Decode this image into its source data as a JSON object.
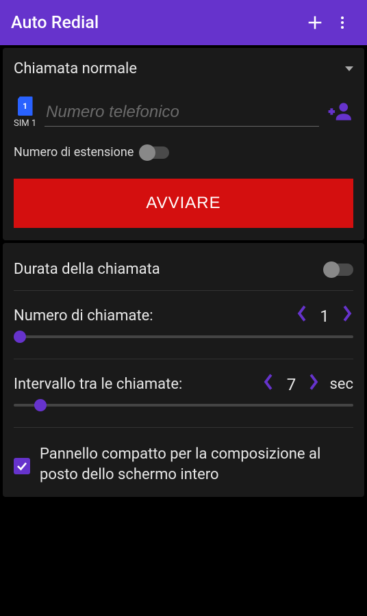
{
  "header": {
    "title": "Auto Redial"
  },
  "callType": {
    "selected": "Chiamata normale"
  },
  "sim": {
    "iconText": "1",
    "label": "SIM 1"
  },
  "phone": {
    "placeholder": "Numero telefonico",
    "value": ""
  },
  "extension": {
    "label": "Numero di estensione",
    "enabled": false
  },
  "startButton": {
    "label": "AVVIARE"
  },
  "callDuration": {
    "label": "Durata della chiamata",
    "enabled": false
  },
  "numCalls": {
    "label": "Numero di chiamate:",
    "value": "1",
    "sliderPercent": 0
  },
  "interval": {
    "label": "Intervallo tra le chiamate:",
    "value": "7",
    "unit": "sec",
    "sliderPercent": 6
  },
  "compactPanel": {
    "label": "Pannello compatto per la composizione al posto dello schermo intero",
    "checked": true
  }
}
